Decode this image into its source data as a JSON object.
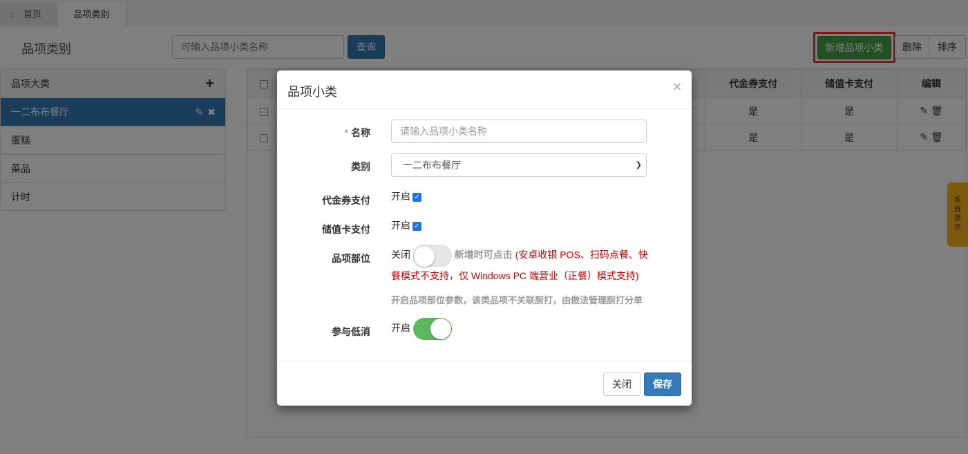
{
  "tabs": [
    {
      "label": "首页",
      "icon": "home-icon"
    },
    {
      "label": "品项类别"
    }
  ],
  "page": {
    "title": "品项类别",
    "search_placeholder": "可输入品项小类名称",
    "query_label": "查询",
    "add_label": "新增品项小类",
    "delete_label": "删除",
    "sort_label": "排序"
  },
  "categories": {
    "header": "品项大类",
    "items": [
      "一二布布餐厅",
      "蛋糕",
      "菜品",
      "计时"
    ]
  },
  "table": {
    "headers": [
      "代金券支付",
      "储值卡支付",
      "编辑"
    ],
    "rows": [
      {
        "voucher": "是",
        "card": "是"
      },
      {
        "voucher": "是",
        "card": "是"
      }
    ]
  },
  "side_tip": "系统提示",
  "modal": {
    "title": "品项小类",
    "close_glyph": "×",
    "name_label": "名称",
    "name_placeholder": "请输入品项小类名称",
    "category_label": "类别",
    "category_value": "一二布布餐厅",
    "voucher_label": "代金券支付",
    "voucher_state": "开启",
    "card_label": "储值卡支付",
    "card_state": "开启",
    "position_label": "品项部位",
    "position_state": "关闭",
    "position_note_gray": "新增时可点击",
    "position_note_red_1": "(安卓收银 POS、扫码点餐、快",
    "position_note_red_2": "餐模式不支持，仅 Windows PC 端营业（正餐）模式支持)",
    "position_hint": "开启品项部位参数，该类品项不关联厨打，由做法管理厨打分单",
    "discount_label": "参与低消",
    "discount_state": "开启",
    "btn_close": "关闭",
    "btn_save": "保存"
  },
  "colors": {
    "primary": "#337ab7",
    "success": "#43a047",
    "highlight": "#e53935",
    "switch_on": "#5cb85c",
    "warning_text": "#cc0000",
    "side_tab": "#f9b31a"
  }
}
